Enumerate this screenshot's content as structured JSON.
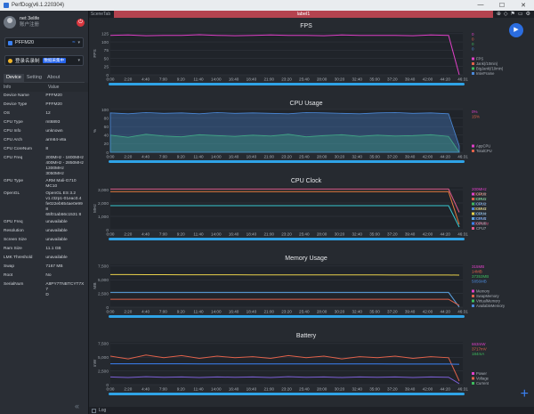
{
  "window": {
    "title": "PerfDog(v6.1.220304)",
    "controls": [
      "—",
      "☐",
      "✕"
    ]
  },
  "user": {
    "name": "net 3elife",
    "sub": "账户注册",
    "power_label": "⏻"
  },
  "device_select": {
    "value": "PFFM20",
    "wifi": "≈",
    "caret": "▾"
  },
  "app_select": {
    "value": "登录名录制",
    "tag": "数据采集中",
    "caret": "▾"
  },
  "tabs": [
    {
      "label": "Device"
    },
    {
      "label": "Setting"
    },
    {
      "label": "About"
    }
  ],
  "info_header": {
    "key": "Info",
    "value": "Value"
  },
  "info_rows": [
    {
      "k": "Device Name",
      "v": "PFFM20"
    },
    {
      "k": "Device Type",
      "v": "PFFM20"
    },
    {
      "k": "OS",
      "v": "12"
    },
    {
      "k": "CPU Type",
      "v": "mt6893"
    },
    {
      "k": "CPU Info",
      "v": "unknown"
    },
    {
      "k": "CPU Arch",
      "v": "arm64-v8a"
    },
    {
      "k": "CPU CoreNum",
      "v": "8"
    },
    {
      "k": "CPU Freq",
      "v": "200MHz - 1800MHz\n400MHz - 2850MHz\n1300MHz\n3050MHz"
    },
    {
      "k": "GPU Type",
      "v": "ARM Mali-G710\nMC10"
    },
    {
      "k": "OpenGL",
      "v": "OpenGL ES 3.2\nv1.r32p1-01eac0.4\nfe022eb654ae0e998\n65f01ab56c1531 8"
    },
    {
      "k": "GPU Freq",
      "v": "unavailable"
    },
    {
      "k": "Resolution",
      "v": "unavailable"
    },
    {
      "k": "Screen Size",
      "v": "unavailable"
    },
    {
      "k": "Ram Size",
      "v": "11.1 GB"
    },
    {
      "k": "LMK Threshold",
      "v": "unavailable"
    },
    {
      "k": "Swap",
      "v": "7167 MB"
    },
    {
      "k": "Root",
      "v": "No"
    },
    {
      "k": "SerialNum",
      "v": "A8PY7TNBTCYT7X7\nD"
    }
  ],
  "collapse_icon": "«",
  "topbar": {
    "scene_tab": "SceneTab",
    "label": "label1",
    "icons": [
      "⊕",
      "◇",
      "⚑",
      "▭",
      "⚙"
    ]
  },
  "play_icon": "▶",
  "bottom": {
    "log_label": "Log",
    "plus": "+"
  },
  "time_ticks": [
    "0:00",
    "2:20",
    "4:40",
    "7:00",
    "9:20",
    "11:40",
    "14:00",
    "16:40",
    "18:40",
    "21:00",
    "23:20",
    "25:40",
    "28:00",
    "30:20",
    "32:40",
    "35:00",
    "37:20",
    "39:40",
    "42:00",
    "44:20",
    "46:31"
  ],
  "colors": {
    "accent": "#2b6de0",
    "fps": "#e040c8",
    "cpu_app": "#3dbb5c",
    "cpu_total": "#4a88d8",
    "battery_power": "#e0614a",
    "battery_voltage": "#3b82f6",
    "battery_current": "#7b5fd6",
    "mem": "#e8d04a",
    "mem_swap": "#5aa2e0",
    "mem_virtual": "#3b82f6"
  },
  "chart_data": [
    {
      "type": "line",
      "title": "FPS",
      "ylabel": "FPS",
      "y_ticks": [
        "0",
        "25",
        "50",
        "75",
        "100",
        "125"
      ],
      "ylim": [
        0,
        130
      ],
      "legend": [
        "FPS",
        "Jank(/10min)",
        "BigJank(/10min)",
        "InterFrame"
      ],
      "right_values": [
        "0",
        "0",
        "0",
        "0"
      ],
      "series": [
        {
          "name": "FPS",
          "values": [
            120,
            121,
            119,
            120,
            120,
            122,
            120,
            119,
            120,
            121,
            120,
            120,
            119,
            121,
            120,
            120,
            120,
            119,
            121,
            120,
            0
          ]
        }
      ]
    },
    {
      "type": "area",
      "title": "CPU Usage",
      "ylabel": "%",
      "y_ticks": [
        "0",
        "20",
        "40",
        "60",
        "80",
        "100"
      ],
      "ylim": [
        0,
        100
      ],
      "legend": [
        "AppCPU",
        "TotalCPU"
      ],
      "right_values": [
        "0%",
        "15%"
      ],
      "series": [
        {
          "name": "AppCPU",
          "values": [
            40,
            35,
            42,
            38,
            36,
            41,
            39,
            37,
            40,
            38,
            42,
            36,
            39,
            41,
            37,
            40,
            38,
            39,
            41,
            37,
            0
          ]
        },
        {
          "name": "TotalCPU",
          "values": [
            92,
            90,
            93,
            91,
            92,
            90,
            93,
            91,
            92,
            91,
            90,
            93,
            92,
            91,
            90,
            92,
            93,
            91,
            92,
            90,
            15
          ]
        }
      ]
    },
    {
      "type": "line",
      "title": "CPU Clock",
      "ylabel": "MHz",
      "y_ticks": [
        "0",
        "1,000",
        "2,000",
        "3,000"
      ],
      "ylim": [
        0,
        3200
      ],
      "legend": [
        "CPU0",
        "CPU1",
        "CPU2",
        "CPU3",
        "CPU4",
        "CPU5",
        "CPU6",
        "CPU7"
      ],
      "right_values": [
        "200MHz",
        "200MHz",
        "200MHz",
        "200MHz",
        "400MHz",
        "400MHz",
        "400MHz",
        "1300MHz"
      ],
      "series": [
        {
          "name": "CPU7",
          "values": [
            3050,
            3050,
            3050,
            3050,
            3050,
            3050,
            3050,
            3050,
            3050,
            3050,
            3050,
            3050,
            3050,
            3050,
            3050,
            3050,
            3050,
            3050,
            3050,
            3050,
            1300
          ]
        },
        {
          "name": "CPU4",
          "values": [
            2850,
            2850,
            2850,
            2850,
            2850,
            2850,
            2850,
            2850,
            2850,
            2850,
            2850,
            2850,
            2850,
            2850,
            2850,
            2850,
            2850,
            2850,
            2850,
            2850,
            400
          ]
        },
        {
          "name": "CPU0",
          "values": [
            1800,
            1800,
            1800,
            1800,
            1800,
            1800,
            1800,
            1800,
            1800,
            1800,
            1800,
            1800,
            1800,
            1800,
            1800,
            1800,
            1800,
            1800,
            1800,
            1800,
            200
          ]
        }
      ]
    },
    {
      "type": "line",
      "title": "Memory Usage",
      "ylabel": "MB",
      "y_ticks": [
        "0",
        "2,500",
        "5,000",
        "7,500"
      ],
      "ylim": [
        0,
        7800
      ],
      "legend": [
        "Memory",
        "SwapMemory",
        "VirtualMemory",
        "AvailableMemory"
      ],
      "right_values": [
        "315MB",
        "14MB",
        "37353MB",
        "5856MB"
      ],
      "series": [
        {
          "name": "AvailableMemory",
          "values": [
            5950,
            5940,
            5930,
            5930,
            5920,
            5920,
            5910,
            5910,
            5900,
            5900,
            5900,
            5890,
            5890,
            5880,
            5880,
            5880,
            5870,
            5870,
            5860,
            5860,
            5856
          ]
        },
        {
          "name": "SwapMemory",
          "values": [
            2700,
            2700,
            2700,
            2700,
            2700,
            2700,
            2700,
            2700,
            2700,
            2700,
            2700,
            2700,
            2700,
            2700,
            2700,
            2700,
            2700,
            2700,
            2700,
            2700,
            14
          ]
        },
        {
          "name": "Memory",
          "values": [
            1450,
            1450,
            1450,
            1450,
            1450,
            1450,
            1450,
            1450,
            1450,
            1450,
            1450,
            1450,
            1450,
            1450,
            1450,
            1450,
            1450,
            1450,
            1450,
            1450,
            315
          ]
        }
      ]
    },
    {
      "type": "line",
      "title": "Battery",
      "ylabel": "mW",
      "y_ticks": [
        "0",
        "2,500",
        "5,000",
        "7,500"
      ],
      "ylim": [
        0,
        7800
      ],
      "legend": [
        "Power",
        "Voltage",
        "Current"
      ],
      "right_values": [
        "663mW",
        "3717mV",
        "184mA"
      ],
      "series": [
        {
          "name": "Power",
          "values": [
            5200,
            4700,
            5400,
            4900,
            5300,
            4800,
            5200,
            4900,
            5100,
            4800,
            5300,
            4900,
            5200,
            4700,
            5100,
            4900,
            5200,
            4800,
            5100,
            4900,
            663
          ]
        },
        {
          "name": "Voltage",
          "values": [
            3800,
            3800,
            3800,
            3800,
            3800,
            3790,
            3790,
            3790,
            3790,
            3780,
            3780,
            3780,
            3780,
            3770,
            3770,
            3770,
            3760,
            3760,
            3760,
            3750,
            3717
          ]
        },
        {
          "name": "Current",
          "values": [
            1400,
            1300,
            1450,
            1350,
            1400,
            1300,
            1400,
            1350,
            1400,
            1300,
            1450,
            1350,
            1400,
            1300,
            1400,
            1350,
            1400,
            1300,
            1400,
            1350,
            184
          ]
        }
      ]
    }
  ]
}
